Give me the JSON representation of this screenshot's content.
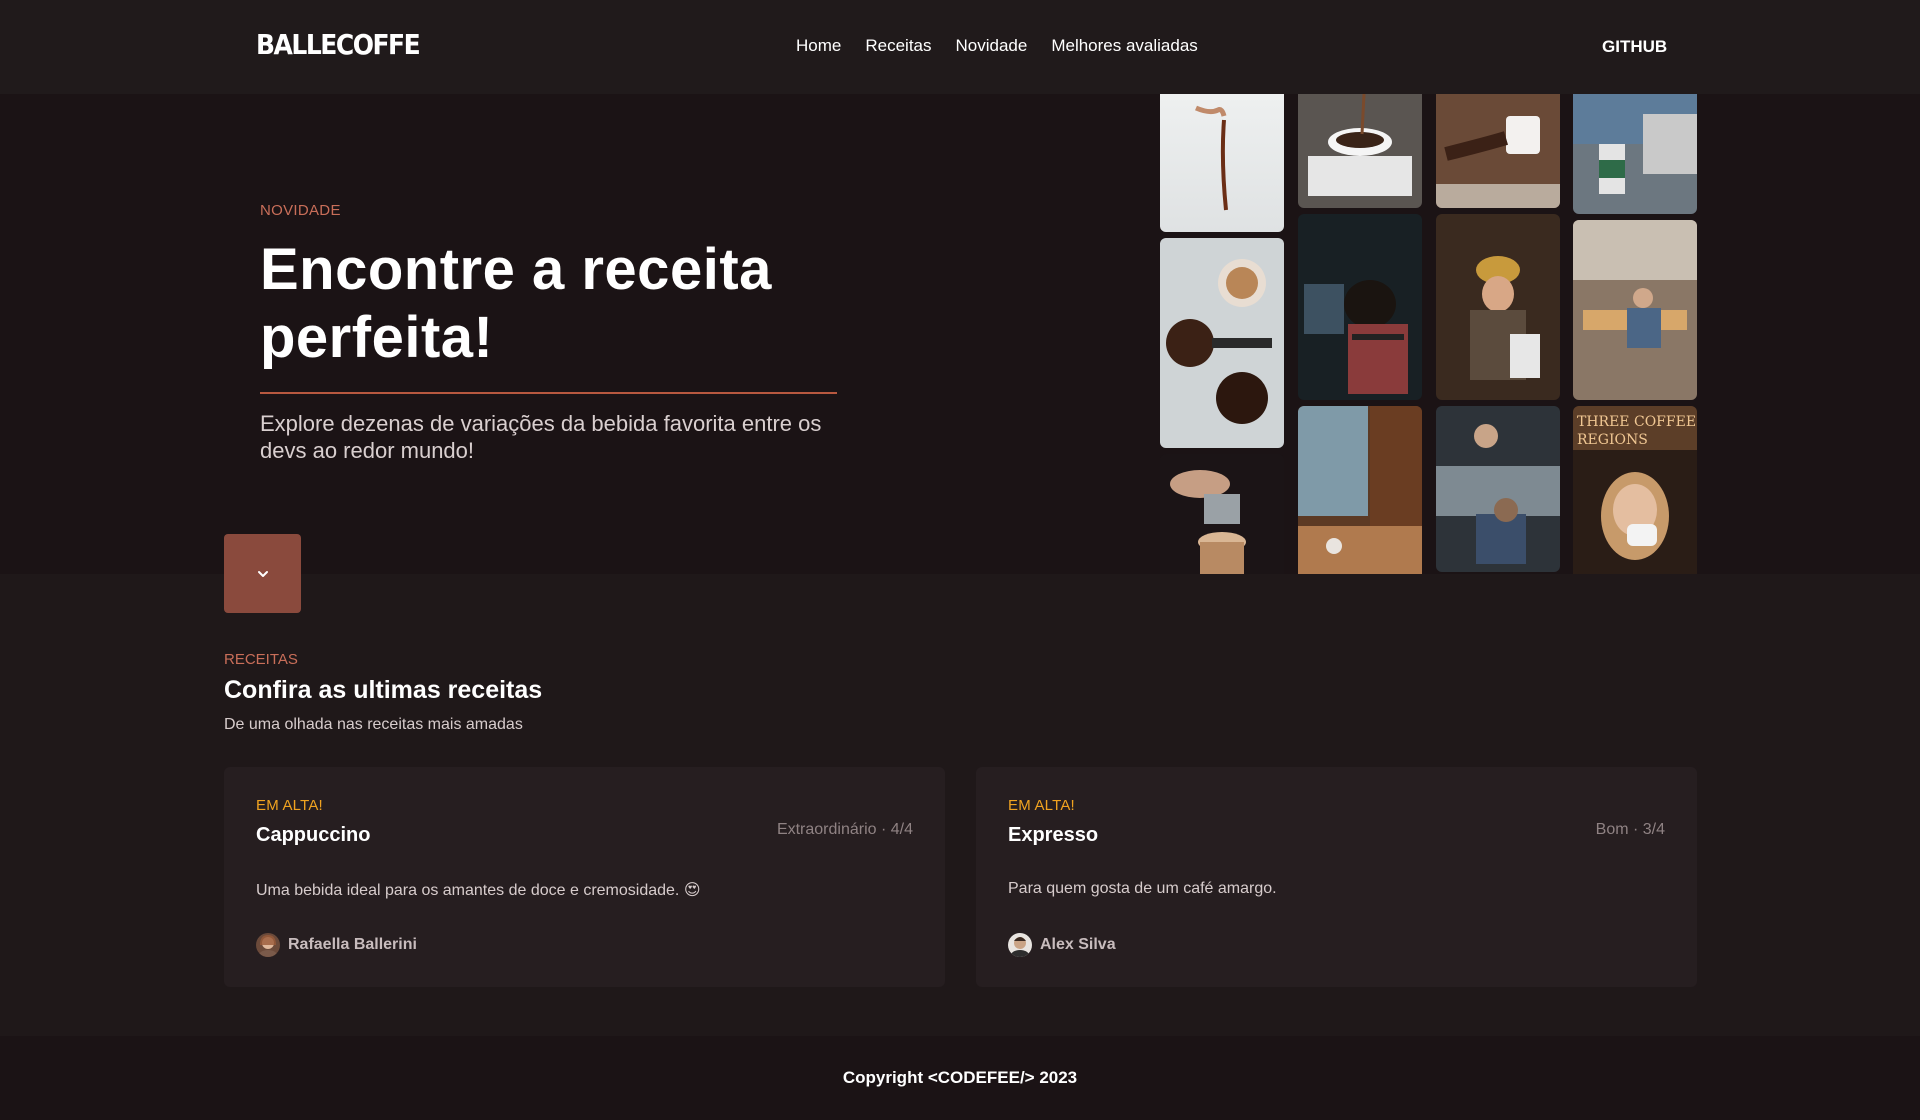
{
  "header": {
    "logo": "BALLECOFFE",
    "nav": [
      "Home",
      "Receitas",
      "Novidade",
      "Melhores avaliadas"
    ],
    "github": "GITHUB"
  },
  "hero": {
    "kicker": "NOVIDADE",
    "title": "Encontre a receita perfeita!",
    "subtitle": "Explore dezenas de variações da bebida favorita entre os devs ao redor mundo!",
    "scroll_icon": "chevron-down-icon"
  },
  "recipes": {
    "kicker": "RECEITAS",
    "title": "Confira as ultimas receitas",
    "subtitle": "De uma olhada nas receitas mais amadas",
    "cards": [
      {
        "badge": "EM ALTA!",
        "name": "Cappuccino",
        "rating": "Extraordinário · 4/4",
        "description": "Uma bebida ideal para os amantes de doce e cremosidade. 😍",
        "author": "Rafaella Ballerini"
      },
      {
        "badge": "EM ALTA!",
        "name": "Expresso",
        "rating": "Bom · 3/4",
        "description": "Para quem gosta de um café amargo.",
        "author": "Alex Silva"
      }
    ]
  },
  "footer": {
    "copyright": "Copyright <CODEFEE/> 2023"
  },
  "colors": {
    "accent": "#c96e59",
    "badge": "#f0a320",
    "button": "#8a4a3d",
    "background": "#1f1819"
  }
}
